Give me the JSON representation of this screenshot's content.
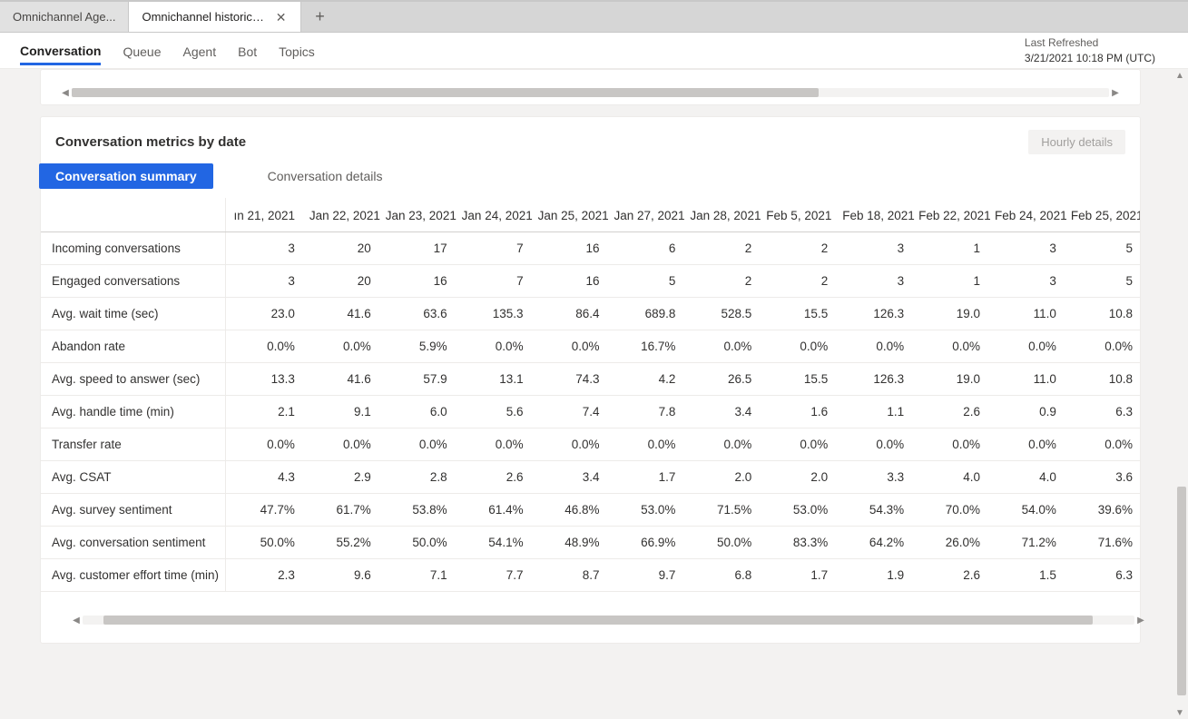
{
  "tabs": {
    "inactive": "Omnichannel Age...",
    "active": "Omnichannel historical an..."
  },
  "subnav": {
    "items": [
      "Conversation",
      "Queue",
      "Agent",
      "Bot",
      "Topics"
    ],
    "selected": 0
  },
  "refresh": {
    "label": "Last Refreshed",
    "value": "3/21/2021 10:18 PM (UTC)"
  },
  "card": {
    "title": "Conversation metrics by date",
    "hourly_label": "Hourly details",
    "view_tabs": [
      "Conversation summary",
      "Conversation details"
    ]
  },
  "table": {
    "date_headers_first_partial": "ın 21, 2021",
    "date_headers": [
      "Jan 22, 2021",
      "Jan 23, 2021",
      "Jan 24, 2021",
      "Jan 25, 2021",
      "Jan 27, 2021",
      "Jan 28, 2021",
      "Feb 5, 2021",
      "Feb 18, 2021",
      "Feb 22, 2021",
      "Feb 24, 2021",
      "Feb 25, 2021"
    ],
    "metrics": [
      {
        "label": "Incoming conversations",
        "values": [
          "3",
          "20",
          "17",
          "7",
          "16",
          "6",
          "2",
          "2",
          "3",
          "1",
          "3",
          "5"
        ]
      },
      {
        "label": "Engaged conversations",
        "values": [
          "3",
          "20",
          "16",
          "7",
          "16",
          "5",
          "2",
          "2",
          "3",
          "1",
          "3",
          "5"
        ]
      },
      {
        "label": "Avg. wait time (sec)",
        "values": [
          "23.0",
          "41.6",
          "63.6",
          "135.3",
          "86.4",
          "689.8",
          "528.5",
          "15.5",
          "126.3",
          "19.0",
          "11.0",
          "10.8"
        ]
      },
      {
        "label": "Abandon rate",
        "values": [
          "0.0%",
          "0.0%",
          "5.9%",
          "0.0%",
          "0.0%",
          "16.7%",
          "0.0%",
          "0.0%",
          "0.0%",
          "0.0%",
          "0.0%",
          "0.0%"
        ]
      },
      {
        "label": "Avg. speed to answer (sec)",
        "values": [
          "13.3",
          "41.6",
          "57.9",
          "13.1",
          "74.3",
          "4.2",
          "26.5",
          "15.5",
          "126.3",
          "19.0",
          "11.0",
          "10.8"
        ]
      },
      {
        "label": "Avg. handle time (min)",
        "values": [
          "2.1",
          "9.1",
          "6.0",
          "5.6",
          "7.4",
          "7.8",
          "3.4",
          "1.6",
          "1.1",
          "2.6",
          "0.9",
          "6.3"
        ]
      },
      {
        "label": "Transfer rate",
        "values": [
          "0.0%",
          "0.0%",
          "0.0%",
          "0.0%",
          "0.0%",
          "0.0%",
          "0.0%",
          "0.0%",
          "0.0%",
          "0.0%",
          "0.0%",
          "0.0%"
        ]
      },
      {
        "label": "Avg. CSAT",
        "values": [
          "4.3",
          "2.9",
          "2.8",
          "2.6",
          "3.4",
          "1.7",
          "2.0",
          "2.0",
          "3.3",
          "4.0",
          "4.0",
          "3.6"
        ]
      },
      {
        "label": "Avg. survey sentiment",
        "values": [
          "47.7%",
          "61.7%",
          "53.8%",
          "61.4%",
          "46.8%",
          "53.0%",
          "71.5%",
          "53.0%",
          "54.3%",
          "70.0%",
          "54.0%",
          "39.6%"
        ]
      },
      {
        "label": "Avg. conversation sentiment",
        "values": [
          "50.0%",
          "55.2%",
          "50.0%",
          "54.1%",
          "48.9%",
          "66.9%",
          "50.0%",
          "83.3%",
          "64.2%",
          "26.0%",
          "71.2%",
          "71.6%"
        ]
      },
      {
        "label": "Avg. customer effort time (min)",
        "values": [
          "2.3",
          "9.6",
          "7.1",
          "7.7",
          "8.7",
          "9.7",
          "6.8",
          "1.7",
          "1.9",
          "2.6",
          "1.5",
          "6.3"
        ]
      }
    ]
  }
}
